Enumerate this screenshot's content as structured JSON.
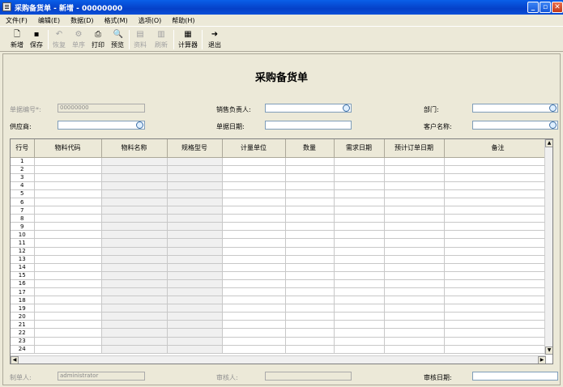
{
  "window": {
    "title": "采购备货单 - 新增 - 00000000"
  },
  "menu": [
    "文件(F)",
    "编辑(E)",
    "数据(D)",
    "格式(M)",
    "选项(O)",
    "帮助(H)"
  ],
  "toolbar": {
    "new": "新增",
    "save": "保存",
    "restore": "恢复",
    "sort": "单序",
    "print": "打印",
    "preview": "预览",
    "data": "资料",
    "refresh": "刷新",
    "calculator": "计算器",
    "exit": "退出"
  },
  "form": {
    "heading": "采购备货单",
    "doc_no_label": "单据编号*:",
    "doc_no_value": "00000000",
    "sales_label": "销售负责人:",
    "dept_label": "部门:",
    "supplier_label": "供应商:",
    "date_label": "单据日期:",
    "customer_label": "客户名称:",
    "maker_label": "制单人:",
    "maker_value": "administrator",
    "reviewer_label": "审核人:",
    "review_date_label": "审核日期:"
  },
  "grid": {
    "columns": [
      "行号",
      "物料代码",
      "物料名称",
      "规格型号",
      "计量单位",
      "数量",
      "需求日期",
      "预计订单日期",
      "备注"
    ],
    "rows": [
      "1",
      "2",
      "3",
      "4",
      "5",
      "6",
      "7",
      "8",
      "9",
      "10",
      "11",
      "12",
      "13",
      "14",
      "15",
      "16",
      "17",
      "18",
      "19",
      "20",
      "21",
      "22",
      "23",
      "24"
    ]
  },
  "colors": {
    "title_bar": "#0a5fe8",
    "window_bg": "#ece9d8"
  }
}
